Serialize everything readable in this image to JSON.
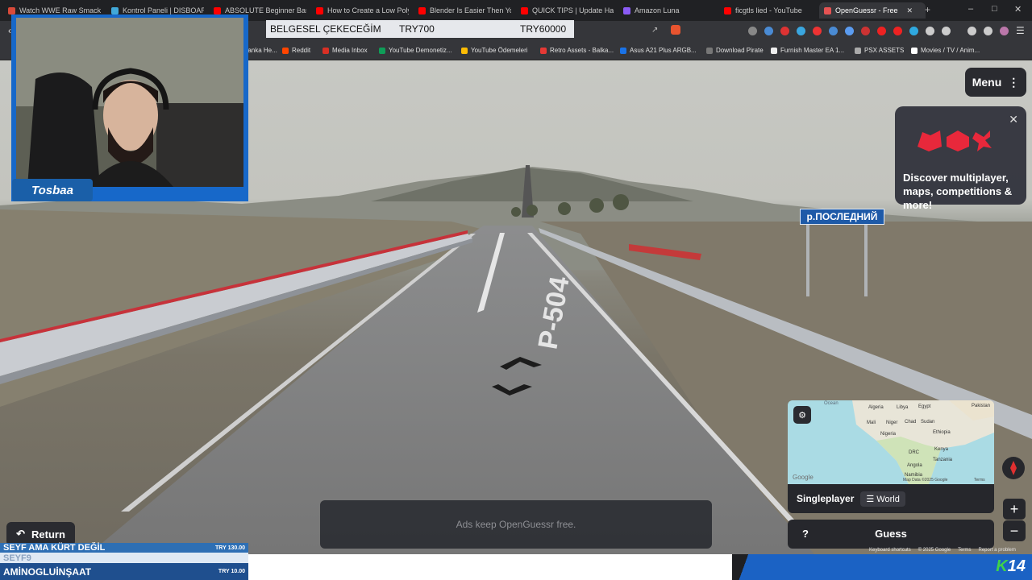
{
  "browser": {
    "tabs": [
      {
        "title": "Watch WWE Raw SmackD",
        "color": "#d84a3a"
      },
      {
        "title": "Kontrol Paneli | DISBOARD",
        "color": "#41a8d8"
      },
      {
        "title": "ABSOLUTE Beginner Basic",
        "color": "#ff0000"
      },
      {
        "title": "How to Create a Low Poly",
        "color": "#ff0000"
      },
      {
        "title": "Blender Is Easier Then You",
        "color": "#ff0000"
      },
      {
        "title": "QUICK TIPS | Update Hand",
        "color": "#ff0000"
      },
      {
        "title": "Amazon Luna",
        "color": "#8b5cf6"
      },
      {
        "title": "ficgtls lied - YouTube",
        "color": "#ff0000"
      },
      {
        "title": "OpenGuessr - Free",
        "color": "#e55353",
        "active": true
      }
    ],
    "new_tab_glyph": "+",
    "bookmarks": [
      {
        "label": "Banka He...",
        "color": "#c44"
      },
      {
        "label": "Reddit",
        "color": "#ff4500"
      },
      {
        "label": "Media Inbox",
        "color": "#d93025"
      },
      {
        "label": "YouTube Demonetiz...",
        "color": "#0f9d58"
      },
      {
        "label": "YouTube Ödemeleri",
        "color": "#fbbc04"
      },
      {
        "label": "Retro Assets - Balka...",
        "color": "#e53935"
      },
      {
        "label": "Asus A21 Plus ARGB...",
        "color": "#1a73e8"
      },
      {
        "label": "Download Pirate",
        "color": "#777"
      },
      {
        "label": "Furnish Master EA 1...",
        "color": "#eee"
      },
      {
        "label": "PSX ASSETS",
        "color": "#aaa"
      },
      {
        "label": "Movies / TV / Anim...",
        "color": "#fff"
      }
    ]
  },
  "stream": {
    "ticker_top": {
      "text": "BELGESEL ÇEKECEĞİM",
      "amount1": "TRY700",
      "amount2": "TRY60000"
    },
    "streamer_name": "Tosbaa",
    "bottom_ticker": [
      {
        "name": "SEYF AMA KÜRT DEĞİL",
        "amount": "TRY 130.00"
      },
      {
        "name": "SEYF9",
        "amount": ""
      },
      {
        "name": "AMİNOGLUİNŞAAT",
        "amount": "TRY 10.00"
      }
    ],
    "channel_logo": {
      "k": "K",
      "num": "14"
    }
  },
  "game": {
    "menu_label": "Menu",
    "promo_text": "Discover multiplayer, maps, competitions & more!",
    "road_sign": "р.ПОСЛЕДНИЙ",
    "road_marking": "P-504",
    "map": {
      "labels": [
        "Ocean",
        "Algeria",
        "Libya",
        "Egypt",
        "Pakistan",
        "Mali",
        "Niger",
        "Chad",
        "Sudan",
        "Ethiopia",
        "Nigeria",
        "DRC",
        "Kenya",
        "Tanzania",
        "Angola",
        "Namibia"
      ],
      "attribution": "Map Data ©2025 Google",
      "terms": "Terms",
      "google": "Google"
    },
    "mode_label": "Singleplayer",
    "map_name": "World",
    "guess_label": "Guess",
    "help_label": "?",
    "ads_text": "Ads keep OpenGuessr free.",
    "return_label": "Return",
    "zoom_in": "+",
    "zoom_out": "−",
    "credits": [
      "Keyboard shortcuts",
      "© 2025 Google",
      "Terms",
      "Report a problem"
    ]
  }
}
